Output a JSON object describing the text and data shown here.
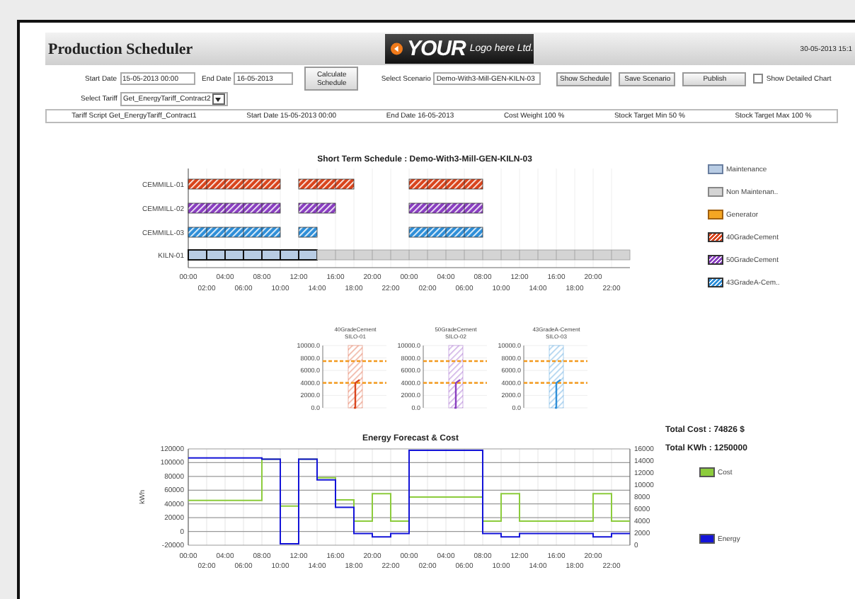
{
  "header": {
    "title": "Production Scheduler",
    "logo": {
      "word": "YOUR",
      "tagline": "Logo here Ltd."
    },
    "date": "30-05-2013 15:1"
  },
  "controls": {
    "start_date": {
      "label": "Start Date",
      "value": "15-05-2013 00:00"
    },
    "end_date": {
      "label": "End Date",
      "value": "16-05-2013"
    },
    "calculate_button": "Calculate Schedule",
    "scenario": {
      "label": "Select Scenario",
      "value": "Demo-With3-Mill-GEN-KILN-03"
    },
    "buttons": [
      "Show Schedule",
      "Save Scenario",
      "Publish"
    ],
    "detailed_chart": {
      "label": "Show Detailed Chart",
      "checked": false
    },
    "tariff": {
      "label": "Select Tariff",
      "value": "Get_EnergyTariff_Contract2"
    }
  },
  "info_bar": [
    "Tariff Script Get_EnergyTariff_Contract1",
    "Start Date 15-05-2013 00:00",
    "End Date 16-05-2013",
    "Cost Weight 100 %",
    "Stock Target Min 50 %",
    "Stock Target Max 100 %"
  ],
  "schedule": {
    "title": "Short Term Schedule : Demo-With3-Mill-GEN-KILN-03",
    "time_labels": [
      "00:00",
      "02:00",
      "04:00",
      "06:00",
      "08:00",
      "10:00",
      "12:00",
      "14:00",
      "16:00",
      "18:00",
      "20:00",
      "22:00",
      "00:00",
      "02:00",
      "04:00",
      "06:00",
      "08:00",
      "10:00",
      "12:00",
      "14:00",
      "16:00",
      "18:00",
      "20:00",
      "22:00"
    ],
    "legend": [
      {
        "name": "Maintenance",
        "kind": "maintenance",
        "color": "#b8cce4"
      },
      {
        "name": "Non Maintenan..",
        "kind": "idle",
        "color": "#d4d4d4"
      },
      {
        "name": "Generator",
        "kind": "generator",
        "color": "#f5a623"
      },
      {
        "name": "40GradeCement",
        "kind": "cementa",
        "color": "#d9441c"
      },
      {
        "name": "50GradeCement",
        "kind": "cementb",
        "color": "#8a3fc0"
      },
      {
        "name": "43GradeA-Cem..",
        "kind": "cementc",
        "color": "#2f8fd8"
      }
    ],
    "rows": [
      {
        "label": "CEMMILL-01",
        "slots": [
          {
            "kind": "cementa"
          },
          {
            "kind": "cementa"
          },
          {
            "kind": "cementa"
          },
          {
            "kind": "cementa"
          },
          {
            "kind": "cementa"
          },
          {
            "kind": "empty"
          },
          {
            "kind": "cementa"
          },
          {
            "kind": "cementa"
          },
          {
            "kind": "cementa"
          },
          {
            "kind": "empty"
          },
          {
            "kind": "empty"
          },
          {
            "kind": "empty"
          },
          {
            "kind": "cementa"
          },
          {
            "kind": "cementa"
          },
          {
            "kind": "cementa"
          },
          {
            "kind": "cementa"
          },
          {
            "kind": "empty"
          },
          {
            "kind": "empty"
          },
          {
            "kind": "empty"
          },
          {
            "kind": "empty"
          },
          {
            "kind": "empty"
          },
          {
            "kind": "empty"
          },
          {
            "kind": "empty"
          },
          {
            "kind": "empty"
          }
        ]
      },
      {
        "label": "CEMMILL-02",
        "slots": [
          {
            "kind": "cementb"
          },
          {
            "kind": "cementb"
          },
          {
            "kind": "cementb"
          },
          {
            "kind": "cementb"
          },
          {
            "kind": "cementb"
          },
          {
            "kind": "empty"
          },
          {
            "kind": "cementb"
          },
          {
            "kind": "cementb"
          },
          {
            "kind": "empty"
          },
          {
            "kind": "empty"
          },
          {
            "kind": "empty"
          },
          {
            "kind": "empty"
          },
          {
            "kind": "cementb"
          },
          {
            "kind": "cementb"
          },
          {
            "kind": "cementb"
          },
          {
            "kind": "cementb"
          },
          {
            "kind": "empty"
          },
          {
            "kind": "empty"
          },
          {
            "kind": "empty"
          },
          {
            "kind": "empty"
          },
          {
            "kind": "empty"
          },
          {
            "kind": "empty"
          },
          {
            "kind": "empty"
          },
          {
            "kind": "empty"
          }
        ]
      },
      {
        "label": "CEMMILL-03",
        "slots": [
          {
            "kind": "cementc"
          },
          {
            "kind": "cementc"
          },
          {
            "kind": "cementc"
          },
          {
            "kind": "cementc"
          },
          {
            "kind": "cementc"
          },
          {
            "kind": "empty"
          },
          {
            "kind": "cementc"
          },
          {
            "kind": "empty"
          },
          {
            "kind": "empty"
          },
          {
            "kind": "empty"
          },
          {
            "kind": "empty"
          },
          {
            "kind": "empty"
          },
          {
            "kind": "cementc"
          },
          {
            "kind": "cementc"
          },
          {
            "kind": "cementc"
          },
          {
            "kind": "cementc"
          },
          {
            "kind": "empty"
          },
          {
            "kind": "empty"
          },
          {
            "kind": "empty"
          },
          {
            "kind": "empty"
          },
          {
            "kind": "empty"
          },
          {
            "kind": "empty"
          },
          {
            "kind": "empty"
          },
          {
            "kind": "empty"
          }
        ]
      },
      {
        "label": "KILN-01",
        "slots": [
          {
            "kind": "maintenance"
          },
          {
            "kind": "maintenance"
          },
          {
            "kind": "maintenance"
          },
          {
            "kind": "maintenance"
          },
          {
            "kind": "maintenance"
          },
          {
            "kind": "maintenance"
          },
          {
            "kind": "maintenance"
          },
          {
            "kind": "idle"
          },
          {
            "kind": "idle"
          },
          {
            "kind": "idle"
          },
          {
            "kind": "idle"
          },
          {
            "kind": "idle"
          },
          {
            "kind": "idle"
          },
          {
            "kind": "idle"
          },
          {
            "kind": "idle"
          },
          {
            "kind": "idle"
          },
          {
            "kind": "idle"
          },
          {
            "kind": "idle"
          },
          {
            "kind": "idle"
          },
          {
            "kind": "idle"
          },
          {
            "kind": "idle"
          },
          {
            "kind": "idle"
          },
          {
            "kind": "idle"
          },
          {
            "kind": "idle"
          }
        ]
      }
    ]
  },
  "stock_charts": [
    {
      "title": "40GradeCement",
      "subtitle": "SILO-01",
      "color": "#d9441c",
      "y_labels": [
        "10000.0",
        "8000.0",
        "6000.0",
        "4000.0",
        "2000.0",
        "0.0"
      ]
    },
    {
      "title": "50GradeCement",
      "subtitle": "SILO-02",
      "color": "#8a3fc0",
      "y_labels": [
        "10000.0",
        "8000.0",
        "6000.0",
        "4000.0",
        "2000.0",
        "0.0"
      ]
    },
    {
      "title": "43GradeA-Cement",
      "subtitle": "SILO-03",
      "color": "#2f8fd8",
      "y_labels": [
        "10000.0",
        "8000.0",
        "6000.0",
        "4000.0",
        "2000.0",
        "0.0"
      ]
    }
  ],
  "energy": {
    "total_cost": "Total Cost : 74826 $",
    "total_kwh": "Total KWh : 1250000",
    "x_labels_lower": [
      "02:00",
      "06:00",
      "10:00",
      "14:00",
      "18:00",
      "22:00",
      "02:00",
      "06:00",
      "10:00",
      "14:00",
      "18:00",
      "22:00"
    ],
    "right_axis_ticks": [
      "16000",
      "14000",
      "12000",
      "10000",
      "8000",
      "6000",
      "4000",
      "2000",
      "0"
    ],
    "chart_data": {
      "type": "line",
      "title": "Energy Forecast & Cost",
      "ylabel": "kWh",
      "grid": true,
      "legend": true,
      "x": [
        "2013-05-15T00:00",
        "2013-05-15T08:00",
        "2013-05-15T08:00",
        "2013-05-15T10:00",
        "2013-05-15T10:00",
        "2013-05-15T12:00",
        "2013-05-15T12:00",
        "2013-05-15T14:00",
        "2013-05-15T14:00",
        "2013-05-15T16:00",
        "2013-05-15T16:00",
        "2013-05-15T18:00",
        "2013-05-15T18:00",
        "2013-05-15T20:00",
        "2013-05-15T20:00",
        "2013-05-15T22:00",
        "2013-05-15T22:00",
        "2013-05-16T00:00",
        "2013-05-16T00:00",
        "2013-05-16T08:00",
        "2013-05-16T08:00",
        "2013-05-16T10:00",
        "2013-05-16T10:00",
        "2013-05-16T12:00",
        "2013-05-16T12:00",
        "2013-05-16T20:00",
        "2013-05-16T20:00",
        "2013-05-16T22:00",
        "2013-05-16T22:00",
        "2013-05-17T00:00"
      ],
      "xlim": [
        "2013-05-15T00:00",
        "2013-05-17T00:00"
      ],
      "ylim": [
        -20000,
        120000
      ],
      "xticks": [
        {
          "value": "2013-05-15T00:00",
          "label": "00:00"
        },
        {
          "value": "2013-05-15T04:00",
          "label": "04:00"
        },
        {
          "value": "2013-05-15T08:00",
          "label": "08:00"
        },
        {
          "value": "2013-05-15T12:00",
          "label": "12:00"
        },
        {
          "value": "2013-05-15T16:00",
          "label": "16:00"
        },
        {
          "value": "2013-05-15T20:00",
          "label": "20:00"
        },
        {
          "value": "2013-05-16T00:00",
          "label": "00:00"
        },
        {
          "value": "2013-05-16T04:00",
          "label": "04:00"
        },
        {
          "value": "2013-05-16T08:00",
          "label": "08:00"
        },
        {
          "value": "2013-05-16T12:00",
          "label": "12:00"
        },
        {
          "value": "2013-05-16T16:00",
          "label": "16:00"
        },
        {
          "value": "2013-05-16T20:00",
          "label": "20:00"
        }
      ],
      "yticks": [
        -20000,
        0,
        20000,
        40000,
        60000,
        80000,
        100000,
        120000
      ],
      "series": [
        {
          "name": "Cost",
          "color": "#8ccc3c",
          "values": [
            45000,
            45000,
            105000,
            105000,
            37000,
            37000,
            105000,
            105000,
            78000,
            78000,
            46000,
            46000,
            15000,
            15000,
            55000,
            55000,
            15000,
            15000,
            50000,
            50000,
            15000,
            15000,
            55000,
            55000,
            15000,
            15000,
            55000,
            55000,
            15000,
            15000
          ]
        },
        {
          "name": "Energy",
          "color": "#1414d8",
          "values": [
            107000,
            107000,
            105000,
            105000,
            -18000,
            -18000,
            105000,
            105000,
            75000,
            75000,
            35000,
            35000,
            -3000,
            -3000,
            -8000,
            -8000,
            -3000,
            -3000,
            118000,
            118000,
            -3000,
            -3000,
            -8000,
            -8000,
            -3000,
            -3000,
            -8000,
            -8000,
            -3000,
            -3000
          ]
        }
      ]
    }
  }
}
